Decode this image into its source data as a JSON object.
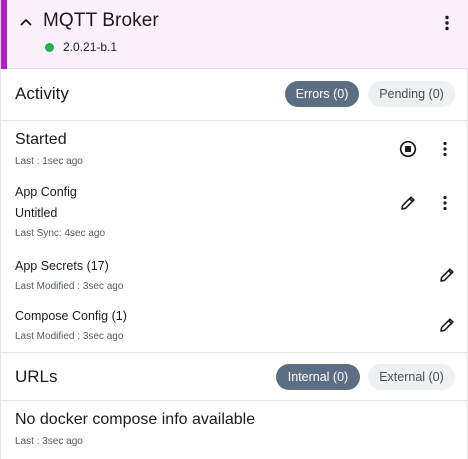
{
  "header": {
    "title": "MQTT Broker",
    "version": "2.0.21-b.1",
    "status_color": "#1fb24a",
    "accent_color": "#b41ec9",
    "collapse_icon": "chevron-up-icon",
    "menu_icon": "more-vert-icon"
  },
  "activity": {
    "title": "Activity",
    "errors_label": "Errors (0)",
    "pending_label": "Pending (0)",
    "active_tab": "errors"
  },
  "items": {
    "started": {
      "title": "Started",
      "sub": "Last : 1sec ago",
      "stop_icon": "stop-circle-icon"
    },
    "app_config": {
      "title": "App Config",
      "value": "Untitled",
      "sub": "Last Sync: 4sec ago",
      "edit_icon": "pencil-icon"
    },
    "app_secrets": {
      "title": "App Secrets (17)",
      "sub": "Last Modified : 3sec ago",
      "edit_icon": "pencil-icon"
    },
    "compose_config": {
      "title": "Compose Config (1)",
      "sub": "Last Modified : 3sec ago",
      "edit_icon": "pencil-icon"
    }
  },
  "urls": {
    "title": "URLs",
    "internal_label": "Internal (0)",
    "external_label": "External (0)",
    "active_tab": "internal"
  },
  "compose_info": {
    "title": "No docker compose info available",
    "sub": "Last : 3sec ago"
  }
}
